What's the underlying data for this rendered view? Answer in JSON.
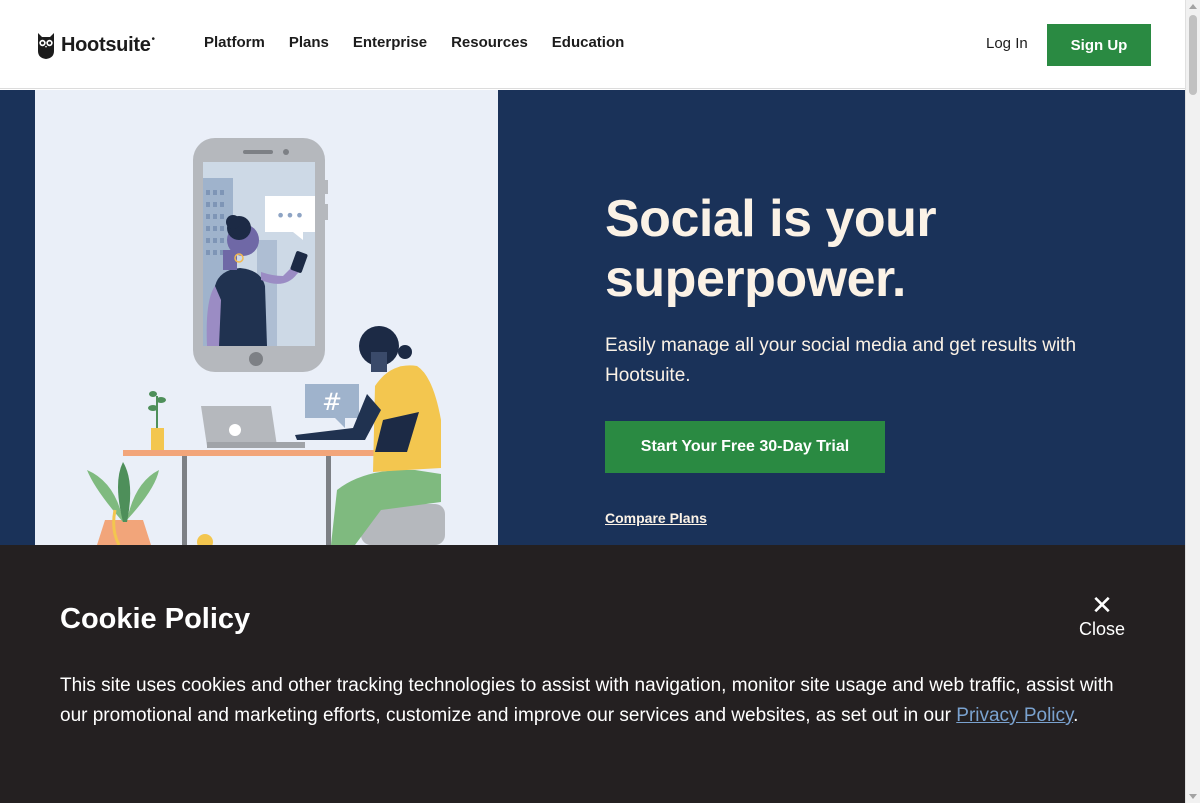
{
  "header": {
    "logo_text": "Hootsuite",
    "logo_mark": "•",
    "nav": [
      {
        "label": "Platform"
      },
      {
        "label": "Plans"
      },
      {
        "label": "Enterprise"
      },
      {
        "label": "Resources"
      },
      {
        "label": "Education"
      }
    ],
    "login_label": "Log In",
    "signup_label": "Sign Up"
  },
  "hero": {
    "title": "Social is your superpower.",
    "subtitle": "Easily manage all your social media and get results with Hootsuite.",
    "cta_label": "Start Your Free 30-Day Trial",
    "compare_label": "Compare Plans",
    "illustration": {
      "chat_bubble_text": "•••",
      "hashtag_text": "#"
    }
  },
  "cookie": {
    "title": "Cookie Policy",
    "close_icon": "✕",
    "close_label": "Close",
    "text_before_link": "This site uses cookies and other tracking technologies to assist with navigation, monitor site usage and web traffic, assist with our promotional and marketing efforts, customize and improve our services and websites, as set out in our ",
    "link_text": "Privacy Policy",
    "text_after_link": "."
  },
  "colors": {
    "hero_bg": "#1a3259",
    "brand_green": "#2a8a42",
    "cookie_bg": "#242021",
    "hero_text": "#fbf2e6"
  }
}
